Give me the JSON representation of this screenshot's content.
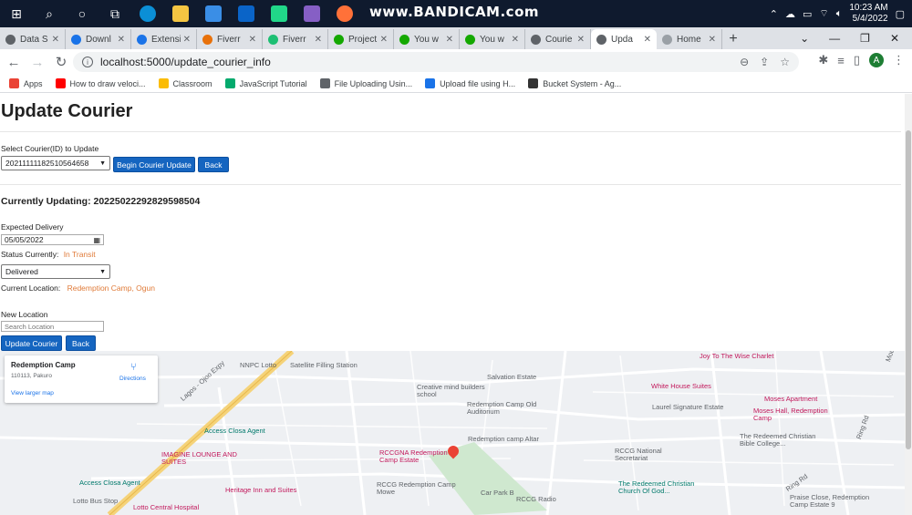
{
  "taskbar": {
    "watermark": "www.BANDICAM.com",
    "time": "10:23 AM",
    "date": "5/4/2022"
  },
  "tabs": [
    {
      "label": "Data S",
      "color": "#5f6368"
    },
    {
      "label": "Downl",
      "color": "#1a73e8"
    },
    {
      "label": "Extensi",
      "color": "#1a73e8"
    },
    {
      "label": "Fiverr",
      "color": "#e8710a"
    },
    {
      "label": "Fiverr",
      "color": "#1dbf73"
    },
    {
      "label": "Project",
      "color": "#14a800"
    },
    {
      "label": "You w",
      "color": "#14a800"
    },
    {
      "label": "You w",
      "color": "#14a800"
    },
    {
      "label": "Courie",
      "color": "#5f6368"
    },
    {
      "label": "Upda",
      "color": "#5f6368",
      "active": true
    },
    {
      "label": "Home",
      "color": "#9aa0a6"
    }
  ],
  "address": {
    "url": "localhost:5000/update_courier_info"
  },
  "bookmarks": [
    {
      "label": "Apps",
      "color": "#ea4335"
    },
    {
      "label": "How to draw veloci...",
      "color": "#ff0000"
    },
    {
      "label": "Classroom",
      "color": "#fbbc04"
    },
    {
      "label": "JavaScript Tutorial",
      "color": "#04aa6d"
    },
    {
      "label": "File Uploading Usin...",
      "color": "#5f6368"
    },
    {
      "label": "Upload file using H...",
      "color": "#1a73e8"
    },
    {
      "label": "Bucket System - Ag...",
      "color": "#333333"
    }
  ],
  "page": {
    "title": "Update Courier",
    "select_label": "Select Courier(ID) to Update",
    "select_value": "20211111182510564658",
    "begin_button": "Begin Courier Update",
    "back_button": "Back",
    "updating_label": "Currently Updating: 20225022292829598504",
    "expected_delivery_label": "Expected Delivery",
    "expected_delivery_value": "05/05/2022",
    "status_label": "Status Currently:",
    "status_value": "In Transit",
    "status_select": "Delivered",
    "current_location_label": "Current Location:",
    "current_location_value": "Redemption Camp, Ogun",
    "new_location_label": "New Location",
    "new_location_placeholder": "Search Location",
    "update_button": "Update Courier",
    "back_button_2": "Back"
  },
  "map": {
    "card_title": "Redemption Camp",
    "card_address": "110113, Pakuro",
    "card_link": "View larger map",
    "directions": "Directions",
    "pois": [
      {
        "label": "NNPC Lotto",
        "cls": "gray"
      },
      {
        "label": "Satellite Filling Station",
        "cls": "gray"
      },
      {
        "label": "Joy To The Wise Charlet",
        "cls": "pink"
      },
      {
        "label": "Salvation Estate",
        "cls": "gray"
      },
      {
        "label": "White House Suites",
        "cls": "pink"
      },
      {
        "label": "Creative mind builders school",
        "cls": "gray"
      },
      {
        "label": "Laurel Signature Estate",
        "cls": "gray"
      },
      {
        "label": "Moses Apartment",
        "cls": "pink"
      },
      {
        "label": "Redemption Camp Old Auditorium",
        "cls": "gray"
      },
      {
        "label": "Moses Hall, Redemption Camp",
        "cls": "pink"
      },
      {
        "label": "Access Closa Agent",
        "cls": "teal"
      },
      {
        "label": "The Redeemed Christian Bible College...",
        "cls": "gray"
      },
      {
        "label": "Redemption camp Altar",
        "cls": "gray"
      },
      {
        "label": "IMAGINE LOUNGE AND SUITES",
        "cls": "pink"
      },
      {
        "label": "RCCGNA Redemption Camp Estate",
        "cls": "pink"
      },
      {
        "label": "RCCG National Secretariat",
        "cls": "gray"
      },
      {
        "label": "Access Closa Agent",
        "cls": "teal"
      },
      {
        "label": "Heritage Inn and Suites",
        "cls": "pink"
      },
      {
        "label": "RCCG Redemption Camp Mowe",
        "cls": "gray"
      },
      {
        "label": "Car Park B",
        "cls": "gray"
      },
      {
        "label": "The Redeemed Christian Church Of God...",
        "cls": "teal"
      },
      {
        "label": "RCCG Radio",
        "cls": "gray"
      },
      {
        "label": "Lotto Bus Stop",
        "cls": "gray"
      },
      {
        "label": "Lotto Central Hospital",
        "cls": "pink"
      },
      {
        "label": "Praise Close, Redemption Camp Estate 9",
        "cls": "gray"
      },
      {
        "label": "Lagos - Ojoo Expy",
        "cls": "gray"
      },
      {
        "label": "Ring Rd",
        "cls": "gray"
      },
      {
        "label": "Ring Rd",
        "cls": "gray"
      },
      {
        "label": "Mount-Zion Rd",
        "cls": "gray"
      }
    ]
  }
}
